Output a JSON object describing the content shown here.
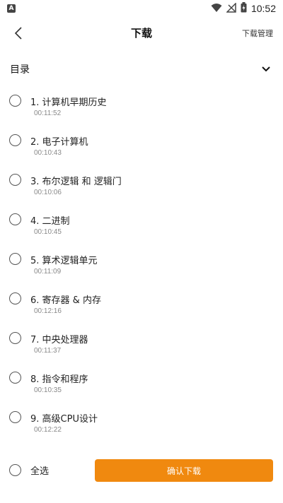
{
  "status_bar": {
    "app_badge": "A",
    "time": "10:52",
    "icons": [
      "notification-a-icon",
      "wifi-icon",
      "no-signal-icon",
      "battery-charging-icon"
    ]
  },
  "header": {
    "title": "下载",
    "manage_label": "下载管理",
    "back_icon": "chevron-left-icon"
  },
  "section": {
    "title": "目录",
    "toggle_icon": "chevron-down-icon"
  },
  "chapters": [
    {
      "title": "1. 计算机早期历史",
      "duration": "00:11:52"
    },
    {
      "title": "2. 电子计算机",
      "duration": "00:10:43"
    },
    {
      "title": "3. 布尔逻辑 和 逻辑门",
      "duration": "00:10:06"
    },
    {
      "title": "4. 二进制",
      "duration": "00:10:45"
    },
    {
      "title": "5. 算术逻辑单元",
      "duration": "00:11:09"
    },
    {
      "title": "6. 寄存器 & 内存",
      "duration": "00:12:16"
    },
    {
      "title": "7. 中央处理器",
      "duration": "00:11:37"
    },
    {
      "title": "8. 指令和程序",
      "duration": "00:10:35"
    },
    {
      "title": "9. 高级CPU设计",
      "duration": "00:12:22"
    }
  ],
  "footer": {
    "select_all_label": "全选",
    "confirm_label": "确认下载"
  },
  "colors": {
    "accent": "#f0890f",
    "text_primary": "#222222",
    "text_secondary": "#888888"
  }
}
